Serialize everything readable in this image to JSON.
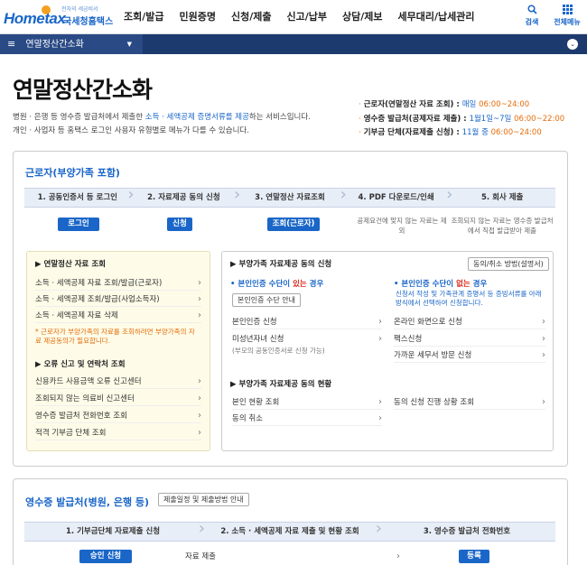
{
  "header": {
    "logo_main": "Hometax",
    "logo_sub": "전자의 세금비서",
    "logo_name": "국세청홈택스",
    "gnb": [
      "조회/발급",
      "민원증명",
      "신청/제출",
      "신고/납부",
      "상담/제보",
      "세무대리/납세관리"
    ],
    "search_label": "검색",
    "allmenu_label": "전체메뉴"
  },
  "subnav": {
    "menu_label": "연말정산간소화"
  },
  "page": {
    "title": "연말정산간소화",
    "intro_line1_a": "병원 · 은행 등 영수증 발급처에서 제출한 ",
    "intro_line1_hl": "소득 · 세액공제 증명서류를 제공",
    "intro_line1_b": "하는 서비스입니다.",
    "intro_line2": "개인 · 사업자 등 홈택스 로그인 사용자 유형별로 메뉴가 다를 수 있습니다."
  },
  "schedule": [
    {
      "label": "근로자(연말정산 자료 조회) : ",
      "date": "매일",
      "time": "06:00~24:00"
    },
    {
      "label": "영수증 발급처(공제자료 제출) : ",
      "date": "1월1일~7일",
      "time": "06:00~22:00"
    },
    {
      "label": "기부금 단체(자료제출 신청) : ",
      "date": "11월 중",
      "time": "06:00~24:00"
    }
  ],
  "worker": {
    "title": "근로자(부양가족 포함)",
    "steps": [
      "1. 공동인증서 등 로그인",
      "2. 자료제공 동의 신청",
      "3. 연말정산 자료조회",
      "4. PDF 다운로드/인쇄",
      "5. 회사 제출"
    ],
    "btn_login": "로그인",
    "btn_apply": "신청",
    "btn_query": "조회(근로자)",
    "note4": "공제요건에 맞지 않는 자료는 제외",
    "note5": "조회되지 않는 자료는 영수증 발급처에서 직접 발급받아 제출",
    "left": {
      "head1": "연말정산 자료 조회",
      "links1": [
        "소득 · 세액공제 자료 조회/발급(근로자)",
        "소득 · 세액공제 조회/발급(사업소득자)",
        "소득 · 세액공제 자료 삭제"
      ],
      "note": "* 근로자가 부양가족의 자료를 조회하려면 부양가족의 자료 제공동의가 필요합니다.",
      "head2": "오류 신고 및 연락처 조회",
      "links2": [
        "신용카드 사용금액 오류 신고센터",
        "조회되지 않는 의료비 신고센터",
        "영수증 발급처 전화번호 조회",
        "적격 기부금 단체 조회"
      ]
    },
    "right": {
      "head1": "부양가족 자료제공 동의 신청",
      "guide_btn": "동의/취소 방법(설명서)",
      "has_cert_a": "본인인증 수단이 ",
      "has_cert_r": "있는",
      "has_cert_b": " 경우",
      "cert_btn": "본인인증 수단 안내",
      "no_cert_a": "본인인증 수단이 ",
      "no_cert_r": "없는",
      "no_cert_b": " 경우",
      "no_cert_desc": "신청서 작성 및 가족관계 증명서 등 증빙서류를 아래 방식에서 선택하여 신청합니다.",
      "links_left": [
        "본인인증 신청",
        "미성년자녀 신청"
      ],
      "minor_sub": "(부모의 공동인증서로 신청 가능)",
      "links_right": [
        "온라인 화면으로 신청",
        "팩스신청",
        "가까운 세무서 방문 신청"
      ],
      "head2": "부양가족 자료제공 동의 현황",
      "status_left": [
        "본인 현황 조회",
        "동의 취소"
      ],
      "status_right": [
        "동의 신청 진행 상황 조회"
      ]
    }
  },
  "issuer": {
    "title": "영수증 발급처(병원, 은행 등)",
    "schedule_btn": "제출일정 및 제출방법 안내",
    "steps": [
      "1. 기부금단체 자료제출 신청",
      "2. 소득 · 세액공제 자료 제출 및 현황 조회",
      "3. 영수증 발급처 전화번호"
    ],
    "btn_approve": "승인 신청",
    "link_submit": "자료 제출",
    "btn_register": "등록"
  }
}
